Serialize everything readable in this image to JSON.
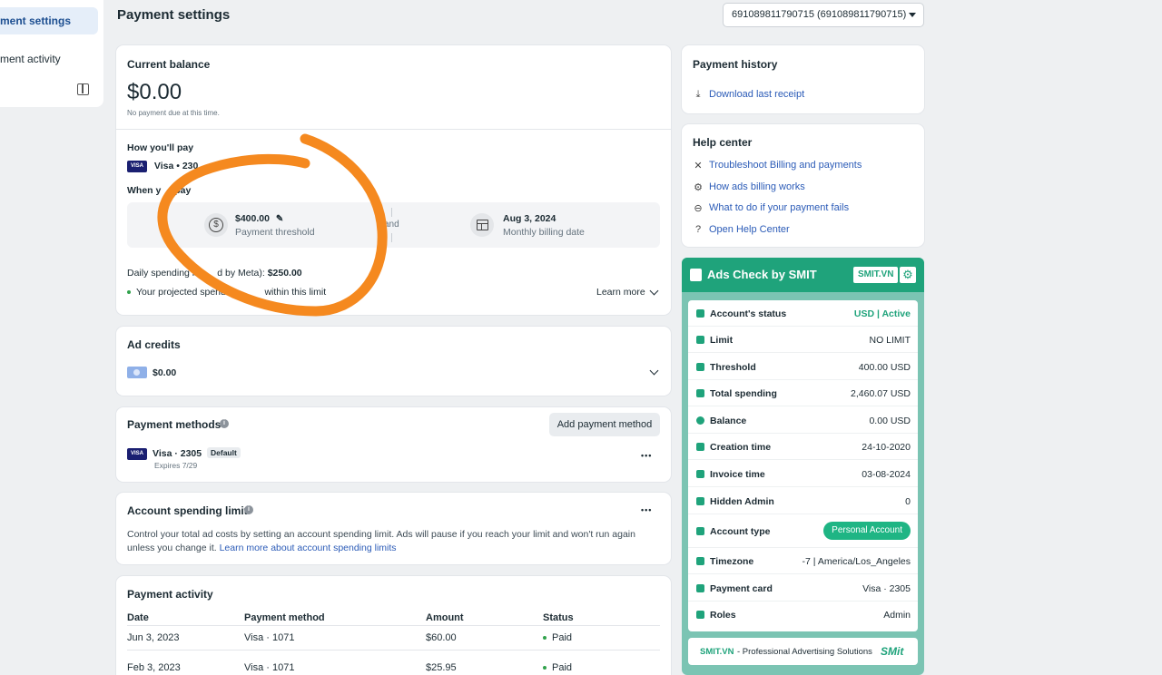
{
  "sidebar": {
    "items": [
      {
        "label": "ment settings"
      },
      {
        "label": "ment activity"
      }
    ]
  },
  "header": {
    "title": "Payment settings",
    "account_selector": "691089811790715 (691089811790715)"
  },
  "balance": {
    "heading": "Current balance",
    "amount": "$0.00",
    "note": "No payment due at this time.",
    "how_pay_heading": "How you'll pay",
    "card_brand": "VISA",
    "card_label": "Visa • 230",
    "when_pay_heading": "When y",
    "when_pay_tail": "pay",
    "threshold_value": "$400.00",
    "threshold_label": "Payment threshold",
    "and_text": "and",
    "billing_date": "Aug 3, 2024",
    "billing_date_label": "Monthly billing date",
    "daily_limit_prefix": "Daily spending lin",
    "daily_limit_mid": "d by Meta):",
    "daily_limit_value": "$250.00",
    "projected_prefix": "Your projected spend to",
    "projected_suffix": "within this limit",
    "learn_more": "Learn more"
  },
  "ad_credits": {
    "heading": "Ad credits",
    "amount": "$0.00"
  },
  "payment_methods": {
    "heading": "Payment methods",
    "add_button": "Add payment method",
    "card_brand": "VISA",
    "card_label": "Visa · 2305",
    "default_badge": "Default",
    "expires": "Expires 7/29",
    "more": "•••"
  },
  "spending_limit": {
    "heading": "Account spending limit",
    "more": "•••",
    "body": "Control your total ad costs by setting an account spending limit. Ads will pause if you reach your limit and won't run again unless you change it.",
    "link": "Learn more about account spending limits"
  },
  "activity": {
    "heading": "Payment activity",
    "columns": [
      "Date",
      "Payment method",
      "Amount",
      "Status"
    ],
    "rows": [
      {
        "date": "Jun 3, 2023",
        "method": "Visa · 1071",
        "amount": "$60.00",
        "status": "Paid"
      },
      {
        "date": "Feb 3, 2023",
        "method": "Visa · 1071",
        "amount": "$25.95",
        "status": "Paid"
      }
    ]
  },
  "payment_history": {
    "heading": "Payment history",
    "download": "Download last receipt"
  },
  "help_center": {
    "heading": "Help center",
    "links": [
      {
        "label": "Troubleshoot Billing and payments",
        "icon": "wrench-icon"
      },
      {
        "label": "How ads billing works",
        "icon": "gear-icon"
      },
      {
        "label": "What to do if your payment fails",
        "icon": "minus-circle-icon"
      },
      {
        "label": "Open Help Center",
        "icon": "question-icon"
      }
    ]
  },
  "smit": {
    "title": "Ads Check by SMIT",
    "badge": "SMIT.VN",
    "rows": [
      {
        "key": "Account's status",
        "value": "USD | Active"
      },
      {
        "key": "Limit",
        "value": "NO LIMIT"
      },
      {
        "key": "Threshold",
        "value": "400.00 USD"
      },
      {
        "key": "Total spending",
        "value": "2,460.07 USD"
      },
      {
        "key": "Balance",
        "value": "0.00 USD"
      },
      {
        "key": "Creation time",
        "value": "24-10-2020"
      },
      {
        "key": "Invoice time",
        "value": "03-08-2024"
      },
      {
        "key": "Hidden Admin",
        "value": "0"
      },
      {
        "key": "Account type",
        "value": "Personal Account"
      },
      {
        "key": "Timezone",
        "value": "-7 | America/Los_Angeles"
      },
      {
        "key": "Payment card",
        "value": "Visa · 2305"
      },
      {
        "key": "Roles",
        "value": "Admin"
      }
    ],
    "footer_brand": "SMIT.VN",
    "footer_text": " - Professional Advertising Solutions",
    "footer_logo": "SMit"
  },
  "colors": {
    "accent": "#1fa37b",
    "annotation": "#f5891f",
    "link": "#2b5bb7"
  }
}
